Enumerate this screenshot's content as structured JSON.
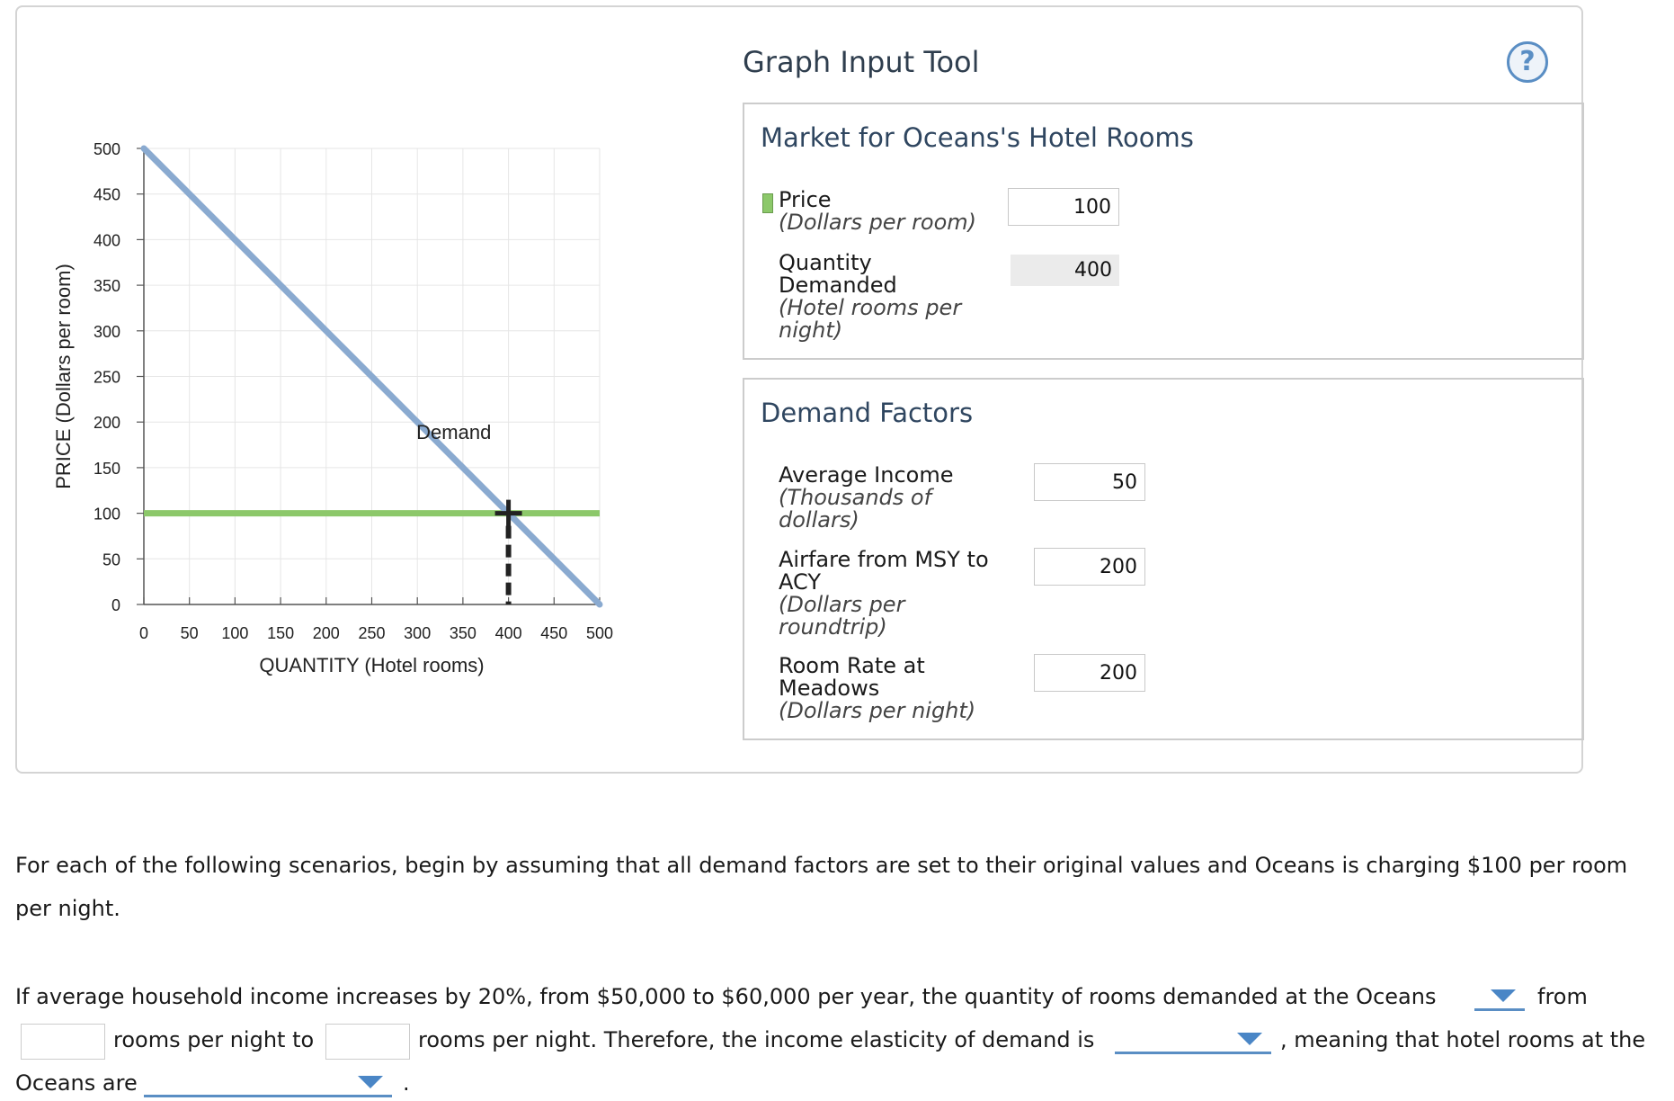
{
  "tool_title": "Graph Input Tool",
  "help_label": "?",
  "market_box": {
    "title": "Market for Oceans's Hotel Rooms",
    "price_label": "Price",
    "price_unit": "(Dollars per room)",
    "price_value": "100",
    "qd_label_1": "Quantity",
    "qd_label_2": "Demanded",
    "qd_unit_1": "(Hotel rooms per",
    "qd_unit_2": "night)",
    "qd_value": "400"
  },
  "factors_box": {
    "title": "Demand Factors",
    "income_label": "Average Income",
    "income_unit_1": "(Thousands of",
    "income_unit_2": "dollars)",
    "income_value": "50",
    "airfare_label_1": "Airfare from MSY to",
    "airfare_label_2": "ACY",
    "airfare_unit_1": "(Dollars per",
    "airfare_unit_2": "roundtrip)",
    "airfare_value": "200",
    "meadows_label_1": "Room Rate at",
    "meadows_label_2": "Meadows",
    "meadows_unit": "(Dollars per night)",
    "meadows_value": "200"
  },
  "question": {
    "intro_1": "For each of the following scenarios, begin by assuming that all demand factors are set to their original values and Oceans is charging $100 per room",
    "intro_2": "per night.",
    "q_line1": "If average household income increases by 20%, from $50,000 to $60,000 per year, the quantity of rooms demanded at the Oceans",
    "q_from": "from",
    "q_rooms_to": "rooms per night to",
    "q_rooms_therefore": "rooms per night. Therefore, the income elasticity of demand is",
    "q_meaning": ", meaning that hotel rooms at the",
    "q_oceans_are": "Oceans are",
    "q_period": "."
  },
  "colors": {
    "demand": "#8aaad0",
    "price_line": "#8cc86a",
    "title": "#2f3e4e",
    "accent": "#5a8ec4"
  },
  "chart_data": {
    "type": "line",
    "xlabel": "QUANTITY (Hotel rooms)",
    "ylabel": "PRICE (Dollars per room)",
    "xlim": [
      0,
      500
    ],
    "ylim": [
      0,
      500
    ],
    "x_ticks": [
      0,
      50,
      100,
      150,
      200,
      250,
      300,
      350,
      400,
      450,
      500
    ],
    "y_ticks": [
      0,
      50,
      100,
      150,
      200,
      250,
      300,
      350,
      400,
      450,
      500
    ],
    "grid": true,
    "series": [
      {
        "name": "Demand",
        "x": [
          0,
          500
        ],
        "y": [
          500,
          0
        ]
      }
    ],
    "price_line": 100,
    "selected_point": {
      "x": 400,
      "y": 100
    }
  }
}
